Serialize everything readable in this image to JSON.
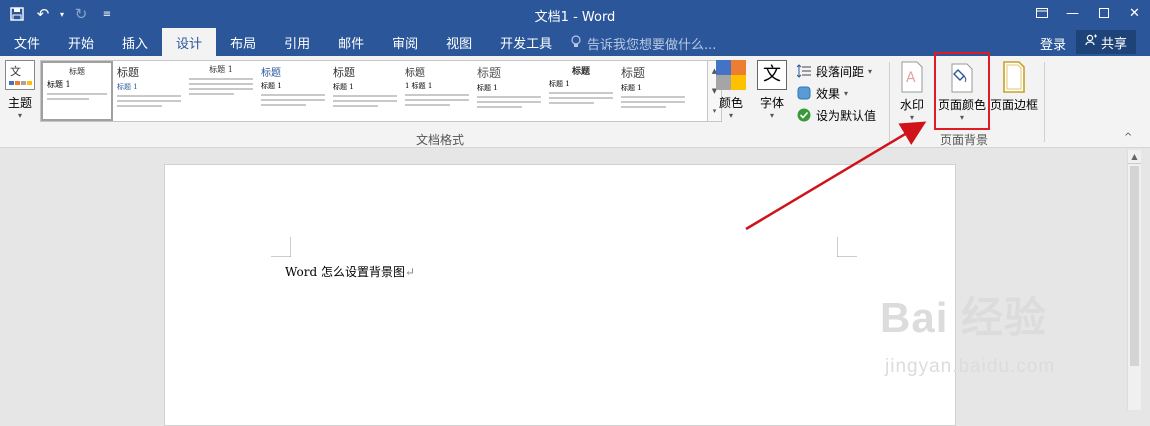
{
  "window": {
    "title": "文档1 - Word"
  },
  "tabs": [
    "文件",
    "开始",
    "插入",
    "设计",
    "布局",
    "引用",
    "邮件",
    "审阅",
    "视图",
    "开发工具"
  ],
  "active_tab": "设计",
  "tell_me": "告诉我您想要做什么...",
  "account": {
    "login": "登录",
    "share": "共享"
  },
  "ribbon": {
    "theme": "主题",
    "styles": [
      {
        "title": "标题",
        "heading": "标题 1"
      },
      {
        "title": "标题",
        "heading": "标题 1"
      },
      {
        "title": "标题 1",
        "heading": ""
      },
      {
        "title": "标题",
        "heading": "标题 1"
      },
      {
        "title": "标题",
        "heading": "标题 1"
      },
      {
        "title": "标题",
        "heading": "1 标题 1"
      },
      {
        "title": "标题",
        "heading": "标题 1"
      },
      {
        "title": "标题",
        "heading": "标题 1"
      },
      {
        "title": "标题",
        "heading": "标题 1"
      }
    ],
    "colors": "颜色",
    "fonts": "字体",
    "fonts_glyph": "文",
    "paragraph_spacing": "段落间距",
    "effects": "效果",
    "set_default": "设为默认值",
    "group_doc_format": "文档格式",
    "watermark": "水印",
    "page_color": "页面颜色",
    "page_borders": "页面边框",
    "group_page_background": "页面背景"
  },
  "document": {
    "text": "Word 怎么设置背景图"
  },
  "overlay": {
    "watermark": "Bai 经验",
    "watermark_url": "jingyan.baidu.com"
  },
  "colors": {
    "brand": "#2b579a",
    "highlight_box": "#e01b24",
    "arrow": "#d0131a",
    "swatch": [
      "#4472c4",
      "#ed7d31",
      "#a5a5a5",
      "#ffc000"
    ]
  }
}
